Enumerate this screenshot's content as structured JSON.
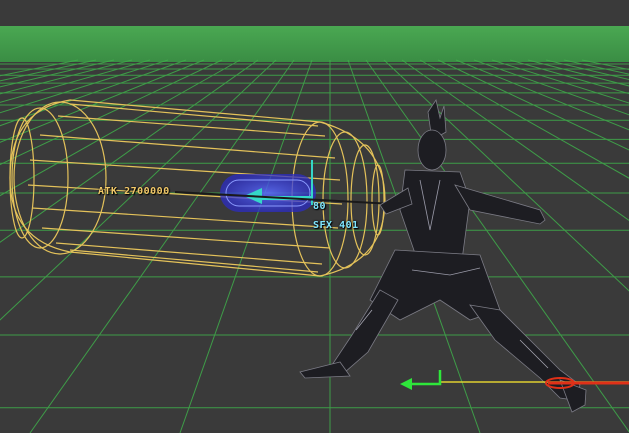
{
  "viewport": {
    "name": "hitbox-preview-viewport",
    "colors": {
      "background": "#3a3a3a",
      "ground_green": "#46a84e",
      "grid_line": "#3fae4b",
      "hitbox_wire": "#e4c25a",
      "sfx_blue": "#3a3cd8",
      "sfx_arrow": "#35d6c8",
      "axis_green": "#2ee63a",
      "axis_yellow": "#e0d030",
      "axis_red": "#e03018"
    }
  },
  "overlays": {
    "attack_label": "ATK 2700000",
    "sfx_value": "80",
    "sfx_label": "SFX 401"
  },
  "gizmo": {
    "icons": [
      "move-arrow-icon",
      "axis-gizmo-icon"
    ]
  }
}
